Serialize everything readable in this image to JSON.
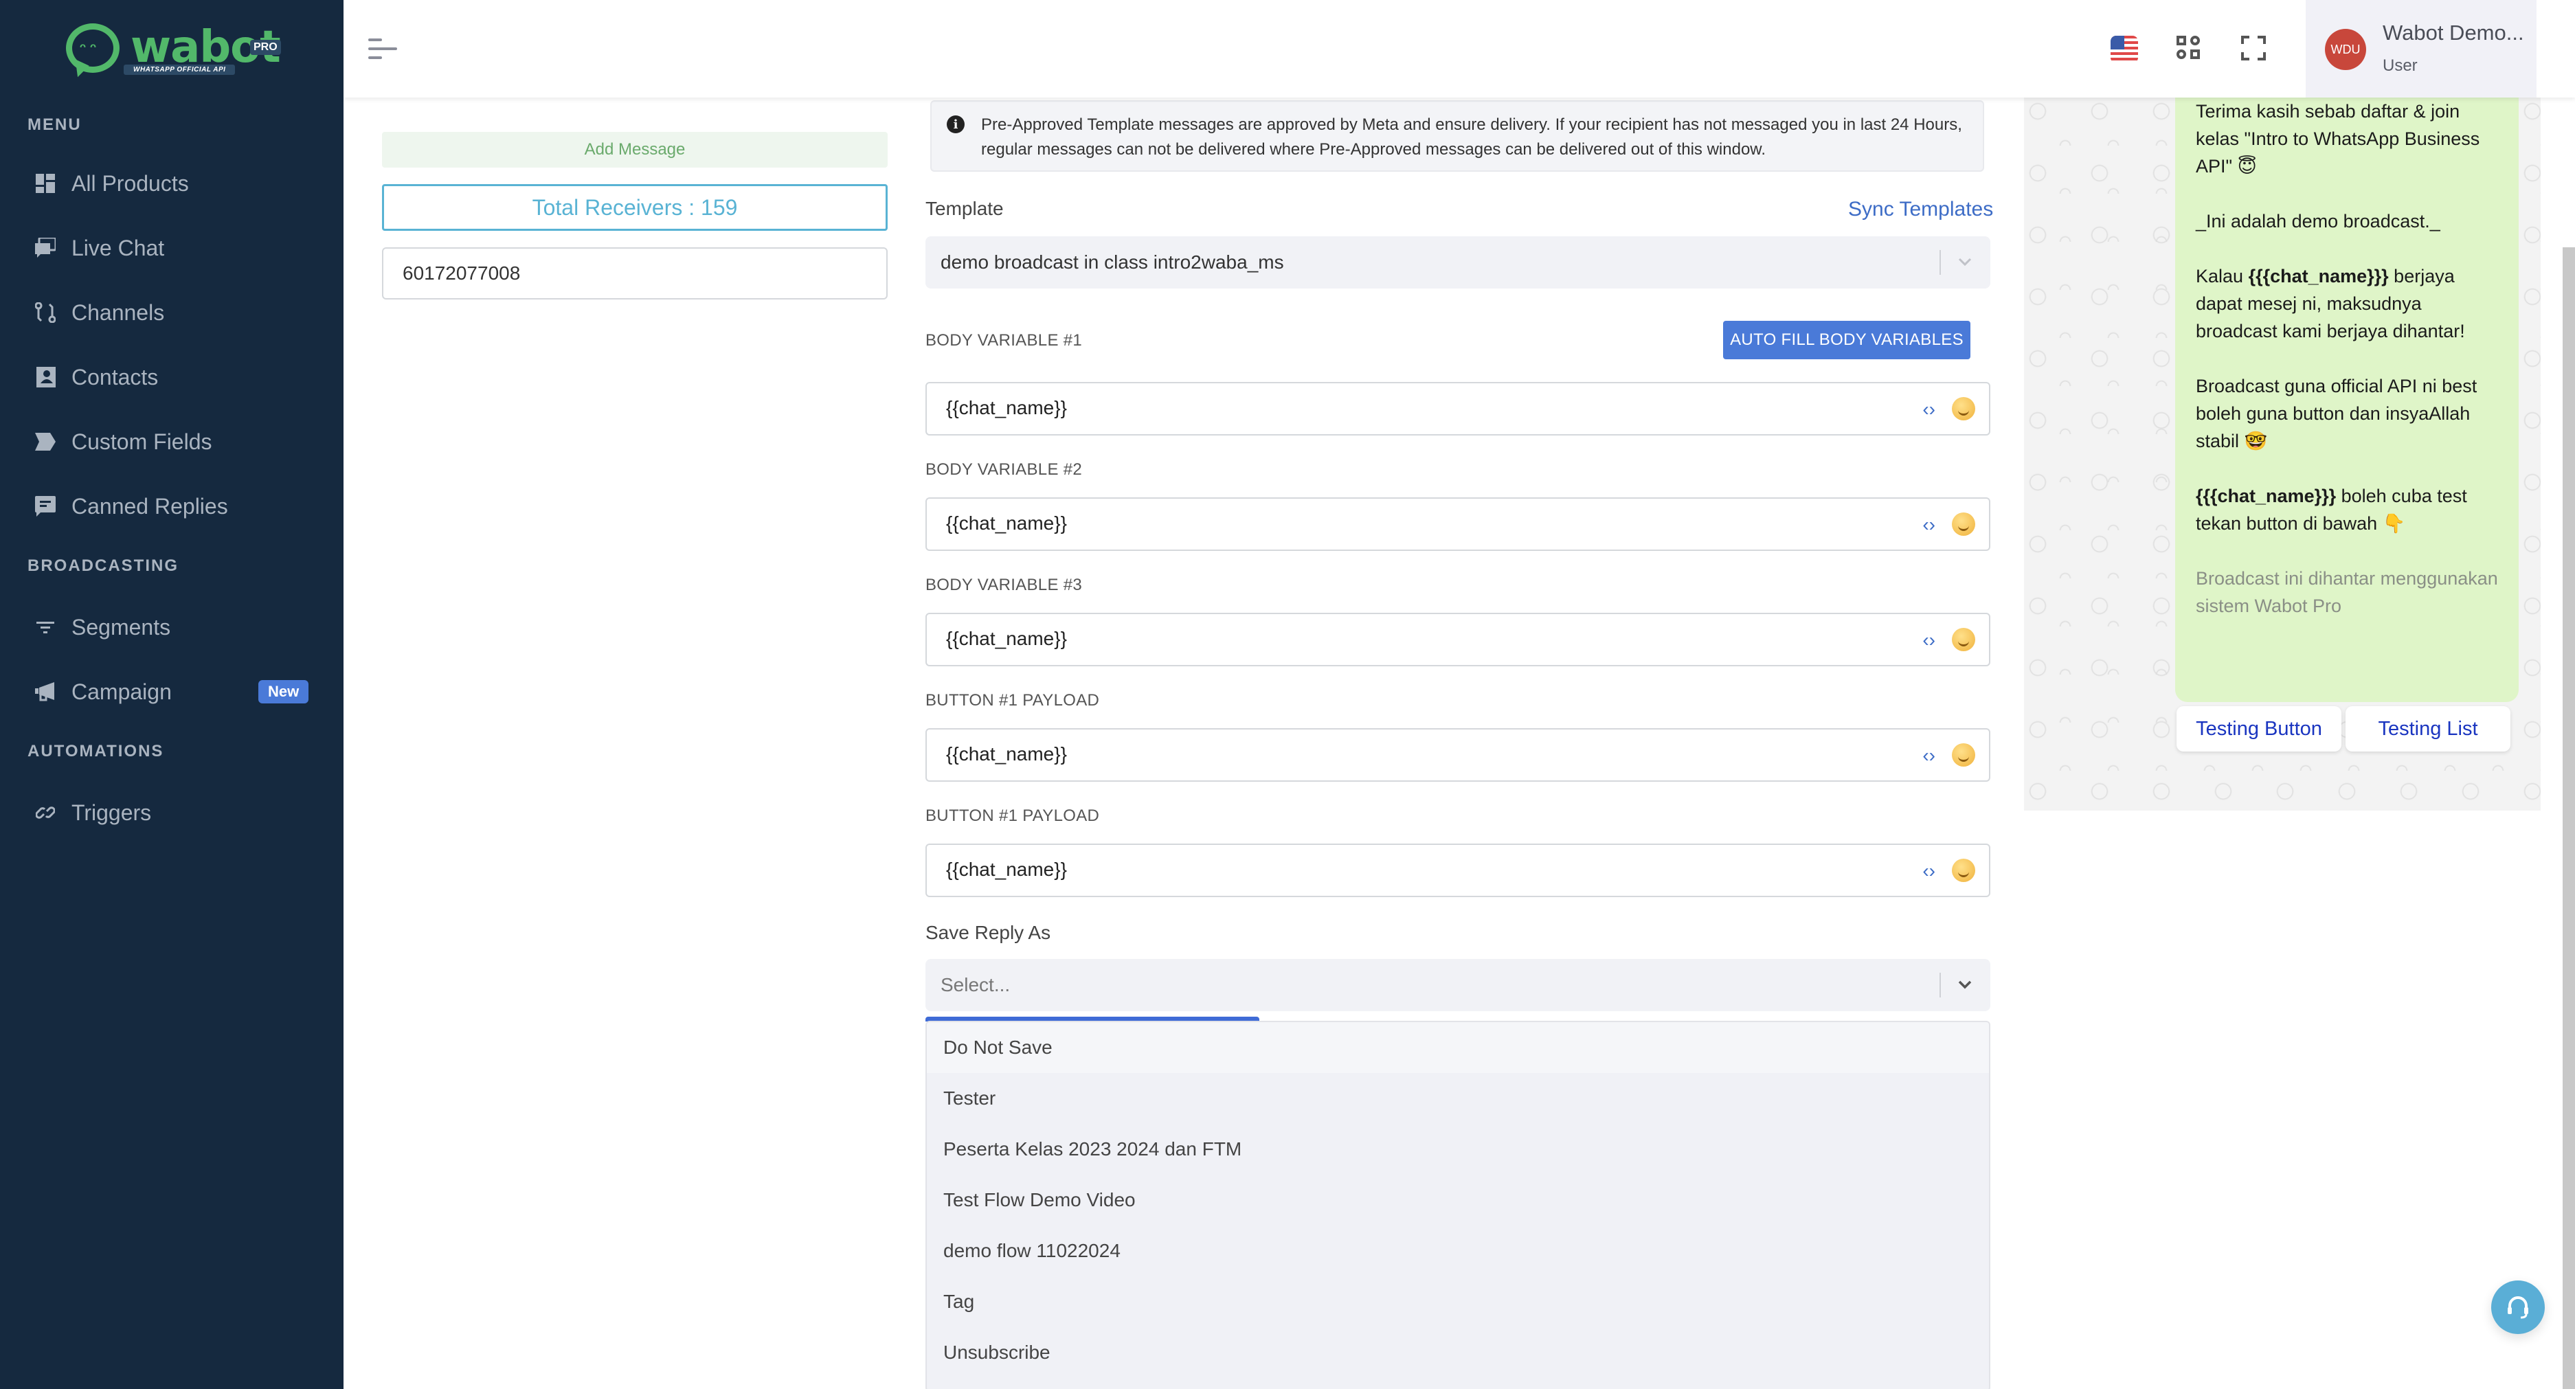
{
  "brand": {
    "name": "wabot",
    "badge": "PRO",
    "tagline": "WHATSAPP OFFICIAL API",
    "color": "#52b86a"
  },
  "sidebar": {
    "sections": [
      {
        "title": "MENU",
        "items": [
          {
            "label": "All Products",
            "icon": "grid-icon"
          },
          {
            "label": "Live Chat",
            "icon": "chat-bubbles-icon"
          },
          {
            "label": "Channels",
            "icon": "git-compare-icon"
          },
          {
            "label": "Contacts",
            "icon": "contact-book-icon"
          },
          {
            "label": "Custom Fields",
            "icon": "label-tag-icon"
          },
          {
            "label": "Canned Replies",
            "icon": "message-text-icon"
          }
        ]
      },
      {
        "title": "BROADCASTING",
        "items": [
          {
            "label": "Segments",
            "icon": "filter-icon"
          },
          {
            "label": "Campaign",
            "icon": "megaphone-icon",
            "badge": "New"
          }
        ]
      },
      {
        "title": "AUTOMATIONS",
        "items": [
          {
            "label": "Triggers",
            "icon": "link-icon"
          }
        ]
      }
    ]
  },
  "header": {
    "language": "en-US flag",
    "user": {
      "initials": "WDU",
      "name": "Wabot Demo...",
      "role": "User",
      "avatar_color": "#c8473b"
    }
  },
  "left": {
    "add_message": "Add Message",
    "total_receivers": "Total Receivers : 159",
    "phone_value": "60172077008"
  },
  "main": {
    "alert": "Pre-Approved Template messages are approved by Meta and ensure delivery. If your recipient has not messaged you in last 24 Hours, regular messages can not be delivered where Pre-Approved messages can be delivered out of this window.",
    "template_label": "Template",
    "sync_templates": "Sync Templates",
    "template_value": "demo broadcast in class intro2waba_ms",
    "autofill_button": "AUTO FILL BODY VARIABLES",
    "variables": [
      {
        "label": "BODY VARIABLE #1",
        "value": "{{chat_name}}"
      },
      {
        "label": "BODY VARIABLE #2",
        "value": "{{chat_name}}"
      },
      {
        "label": "BODY VARIABLE #3",
        "value": "{{chat_name}}"
      },
      {
        "label": "BUTTON #1 PAYLOAD",
        "value": "{{chat_name}}"
      },
      {
        "label": "BUTTON #1 PAYLOAD",
        "value": "{{chat_name}}"
      }
    ],
    "save_reply_label": "Save Reply As",
    "save_reply_placeholder": "Select...",
    "save_reply_options": [
      "Do Not Save",
      "Tester",
      "Peserta Kelas 2023 2024 dan FTM",
      "Test Flow Demo Video",
      "demo flow 11022024",
      "Tag",
      "Unsubscribe"
    ],
    "accent_color": "#4a7ad8"
  },
  "preview": {
    "lines": {
      "p1": "Terima kasih sebab daftar & join kelas \"Intro to WhatsApp Business API\" 😇",
      "p2": "_Ini adalah demo broadcast._",
      "p3_pre": "Kalau ",
      "p3_bold": "{{{chat_name}}}",
      "p3_post": " berjaya dapat mesej ni, maksudnya broadcast kami berjaya dihantar!",
      "p4": "Broadcast guna official API ni best boleh guna button dan insyaAllah stabil 🤓",
      "p5_bold": "{{{chat_name}}}",
      "p5_post": " boleh cuba test tekan button di bawah 👇",
      "footer": "Broadcast ini dihantar menggunakan sistem Wabot Pro"
    },
    "buttons": [
      "Testing Button",
      "Testing List"
    ],
    "bubble_color": "#dff5c8"
  }
}
